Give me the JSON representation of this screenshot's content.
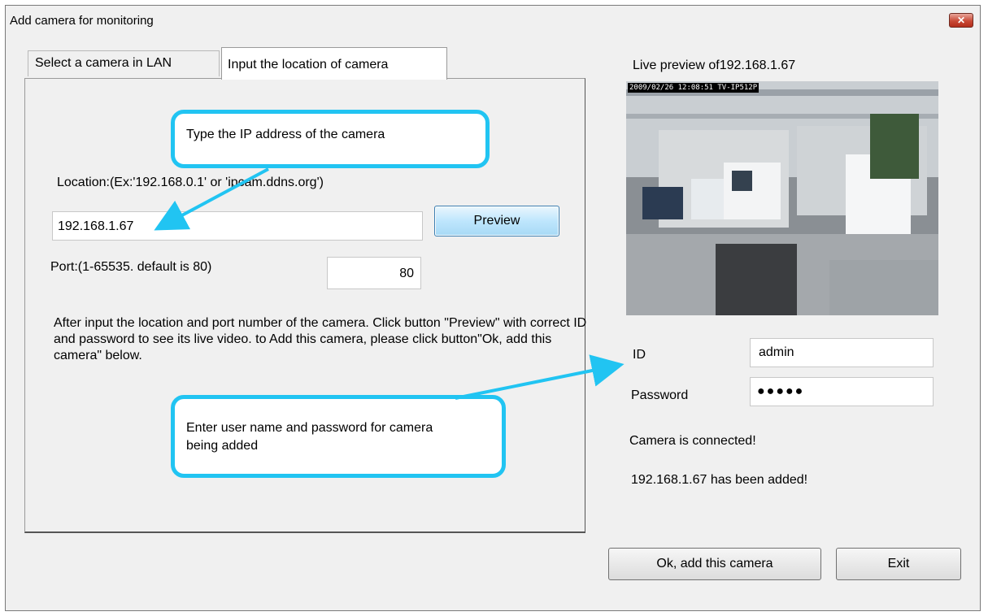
{
  "window": {
    "title": "Add camera for monitoring",
    "close_glyph": "✕"
  },
  "tabs": [
    {
      "label": "Select a camera in LAN",
      "active": false
    },
    {
      "label": "Input the location of camera",
      "active": true
    }
  ],
  "location": {
    "label": "Location:(Ex:'192.168.0.1' or 'ipcam.ddns.org')",
    "value": "192.168.1.67"
  },
  "preview_button": {
    "label": "Preview"
  },
  "port": {
    "label": "Port:(1-65535. default is 80)",
    "value": "80"
  },
  "instructions": "After input the location and port number of the camera. Click button \"Preview\" with correct ID and password to see its live video. to Add this camera, please click button\"Ok, add this camera\" below.",
  "callouts": {
    "ip": "Type the IP address of the camera",
    "user": "Enter user name and password for camera being added"
  },
  "live_preview": {
    "label": "Live preview of192.168.1.67",
    "overlay": "2009/02/26 12:08:51 TV-IP512P"
  },
  "credentials": {
    "id_label": "ID",
    "id_value": "admin",
    "password_label": "Password",
    "password_mask": "●●●●●"
  },
  "status": {
    "connected": "Camera is connected!",
    "added": "192.168.1.67 has been added!"
  },
  "buttons": {
    "ok": "Ok, add this camera",
    "exit": "Exit"
  },
  "colors": {
    "callout_border": "#21c4f2",
    "close_red": "#c94a36"
  }
}
